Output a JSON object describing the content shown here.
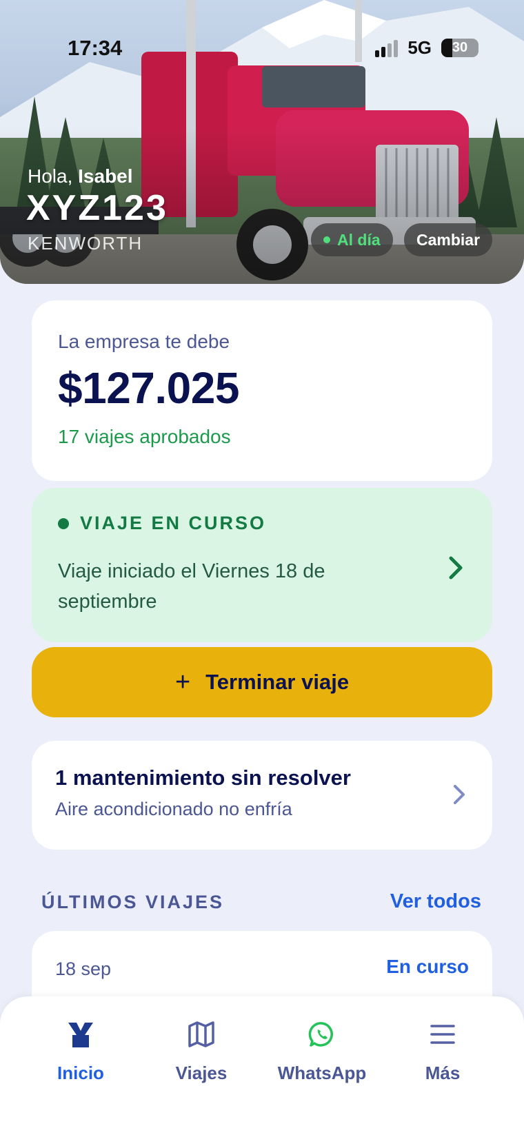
{
  "status_bar": {
    "time": "17:34",
    "network": "5G",
    "battery": "30",
    "battery_level": 0.3
  },
  "hero": {
    "greeting_prefix": "Hola,",
    "user_name": "Isabel",
    "plate": "XYZ123",
    "brand": "KENWORTH",
    "status_badge": "Al día",
    "change_button": "Cambiar"
  },
  "debt_card": {
    "label": "La empresa te debe",
    "amount": "$127.025",
    "approved": "17 viajes aprobados"
  },
  "current_trip": {
    "header": "VIAJE EN CURSO",
    "description": "Viaje iniciado el Viernes 18 de septiembre"
  },
  "finish_button": {
    "label": "Terminar viaje",
    "icon": "plus-icon"
  },
  "maintenance": {
    "title": "1 mantenimiento sin resolver",
    "subtitle": "Aire acondicionado no enfría"
  },
  "recent_trips": {
    "title": "ÚLTIMOS VIAJES",
    "see_all": "Ver todos",
    "items": [
      {
        "date": "18 sep",
        "status": "En curso"
      }
    ]
  },
  "nav": {
    "items": [
      {
        "label": "Inicio",
        "icon": "home-logo-icon",
        "active": true
      },
      {
        "label": "Viajes",
        "icon": "map-icon"
      },
      {
        "label": "WhatsApp",
        "icon": "whatsapp-icon"
      },
      {
        "label": "Más",
        "icon": "menu-icon"
      }
    ]
  },
  "colors": {
    "accent": "#1f5fe0",
    "brand_navy": "#0b1250",
    "success": "#1c9a4c",
    "trip_bg": "#daf5e3",
    "finish_bg": "#e9b10c",
    "page_bg": "#eceef9"
  }
}
